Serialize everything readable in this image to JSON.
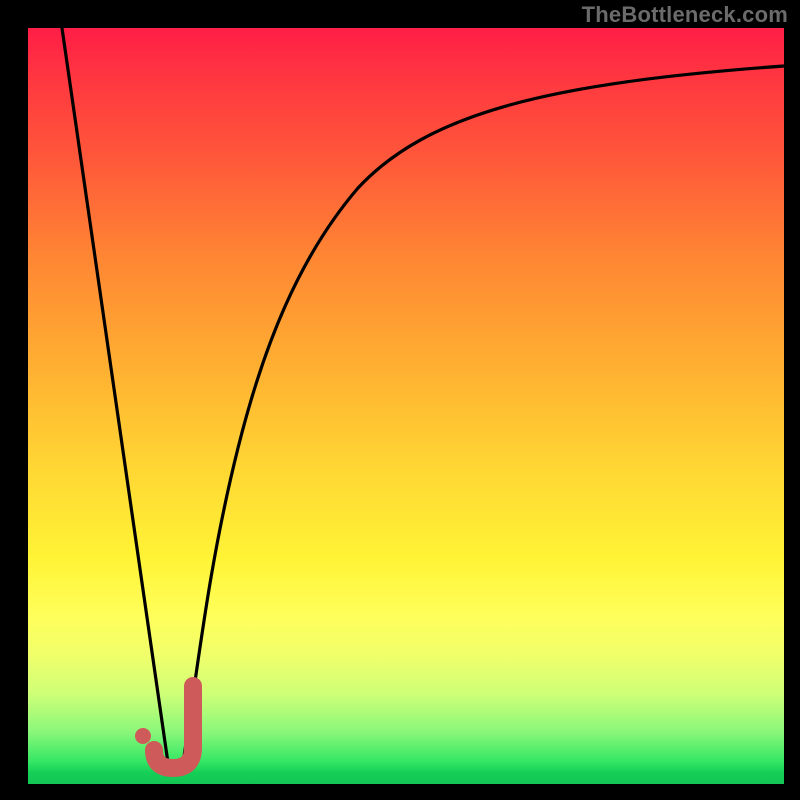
{
  "attribution": "TheBottleneck.com",
  "chart_data": {
    "type": "line",
    "title": "",
    "xlabel": "",
    "ylabel": "",
    "xlim": [
      0,
      100
    ],
    "ylim": [
      0,
      100
    ],
    "series": [
      {
        "name": "left-descent",
        "x": [
          4,
          18
        ],
        "values": [
          100,
          3
        ]
      },
      {
        "name": "right-log-rise",
        "x": [
          20,
          22,
          25,
          28,
          32,
          38,
          46,
          56,
          70,
          85,
          100
        ],
        "values": [
          3,
          15,
          30,
          44,
          56,
          67,
          77,
          84,
          89,
          92,
          94
        ]
      }
    ],
    "annotations": [
      {
        "name": "J-shape",
        "type": "shape",
        "approx_region_x": [
          16,
          22
        ],
        "approx_region_y": [
          2,
          12
        ]
      },
      {
        "name": "dot",
        "type": "point",
        "x": 15.5,
        "y": 6.5
      }
    ],
    "background": {
      "type": "vertical-gradient",
      "stops": [
        {
          "pos": 0,
          "color": "#ff1e46"
        },
        {
          "pos": 50,
          "color": "#ffb032"
        },
        {
          "pos": 75,
          "color": "#ffff5c"
        },
        {
          "pos": 100,
          "color": "#13c554"
        }
      ]
    }
  }
}
